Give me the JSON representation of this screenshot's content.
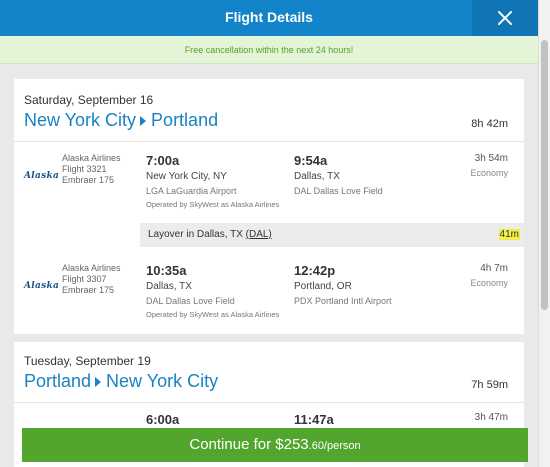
{
  "header": {
    "title": "Flight Details",
    "close_icon": "close-icon"
  },
  "notice": "Free cancellation within the next 24 hours!",
  "outbound": {
    "date": "Saturday, September 16",
    "origin": "New York City",
    "destination": "Portland",
    "duration": "8h 42m",
    "legs": [
      {
        "airline": "Alaska Airlines",
        "flight": "Flight 3321",
        "aircraft": "Embraer 175",
        "logo": "Alaska",
        "dep_time": "7:00a",
        "dep_city": "New York City, NY",
        "dep_airport": "LGA LaGuardia Airport",
        "arr_time": "9:54a",
        "arr_city": "Dallas, TX",
        "arr_airport": "DAL Dallas Love Field",
        "operated": "Operated by SkyWest as Alaska Airlines",
        "duration": "3h 54m",
        "cabin": "Economy"
      },
      {
        "airline": "Alaska Airlines",
        "flight": "Flight 3307",
        "aircraft": "Embraer 175",
        "logo": "Alaska",
        "dep_time": "10:35a",
        "dep_city": "Dallas, TX",
        "dep_airport": "DAL Dallas Love Field",
        "arr_time": "12:42p",
        "arr_city": "Portland, OR",
        "arr_airport": "PDX Portland Intl Airport",
        "operated": "Operated by SkyWest as Alaska Airlines",
        "duration": "4h 7m",
        "cabin": "Economy"
      }
    ],
    "layover": {
      "label": "Layover in Dallas, TX",
      "code": "(DAL)",
      "time": "41m"
    }
  },
  "return": {
    "date": "Tuesday, September 19",
    "origin": "Portland",
    "destination": "New York City",
    "duration": "7h 59m",
    "partial_leg": {
      "dep_time": "6:00a",
      "arr_time": "11:47a",
      "duration": "3h 47m"
    }
  },
  "continue": {
    "label": "Continue for $253",
    "cents": ".60/person"
  },
  "colors": {
    "header": "#1384c9",
    "accent": "#1a82c4",
    "button": "#52a62d",
    "notice_text": "#55a12c"
  }
}
